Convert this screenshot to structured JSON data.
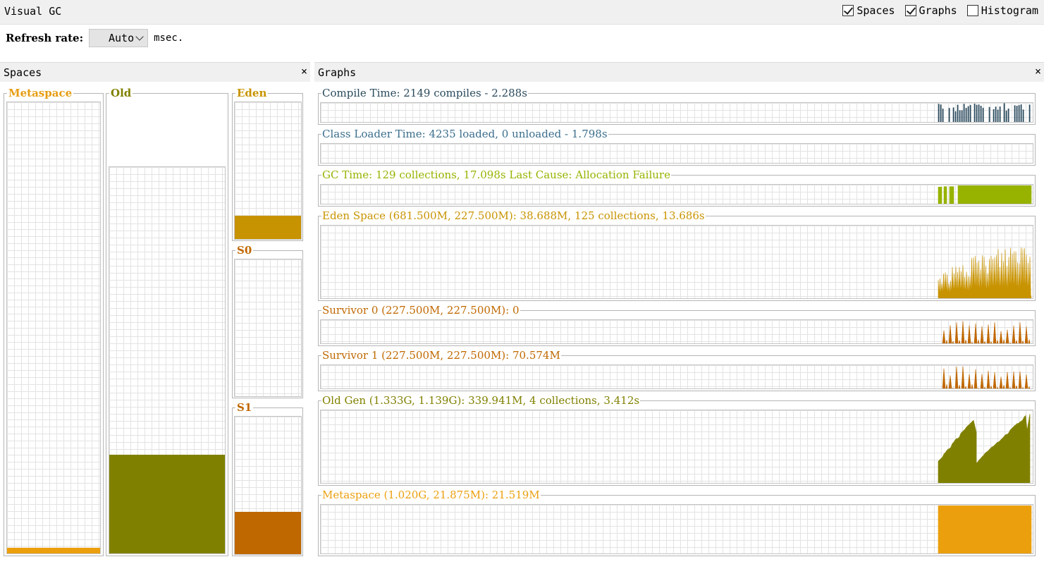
{
  "window": {
    "title": "Visual GC"
  },
  "toggles": [
    {
      "label": "Spaces",
      "checked": true
    },
    {
      "label": "Graphs",
      "checked": true
    },
    {
      "label": "Histogram",
      "checked": false
    }
  ],
  "refresh": {
    "label": "Refresh rate:",
    "value": "Auto",
    "unit": "msec."
  },
  "spaces_panel": {
    "title": "Spaces",
    "close": "×",
    "metaspace": {
      "label": "Metaspace",
      "used_fraction": 0.012,
      "color": "#eb9f0d",
      "label_color": "#e69d12"
    },
    "old": {
      "label": "Old",
      "used_fraction": 0.255,
      "color": "#808000",
      "label_color": "#808000"
    },
    "eden": {
      "label": "Eden",
      "used_fraction": 0.17,
      "color": "#c89300",
      "label_color": "#c89300"
    },
    "s0": {
      "label": "S0",
      "used_fraction": 0.0,
      "color": "#c06800",
      "label_color": "#c06800"
    },
    "s1": {
      "label": "S1",
      "used_fraction": 0.31,
      "color": "#c06800",
      "label_color": "#c06800"
    }
  },
  "graphs_panel": {
    "title": "Graphs",
    "close": "×",
    "graphs": [
      {
        "key": "compile",
        "title": "Compile Time: 2149 compiles - 2.288s",
        "color": "#2a4a5c",
        "kind": "spikes-thin"
      },
      {
        "key": "classloader",
        "title": "Class Loader Time: 4235 loaded, 0 unloaded - 1.798s",
        "color": "#3a6e8c",
        "kind": "none"
      },
      {
        "key": "gc",
        "title": "GC Time: 129 collections, 17.098s  Last Cause: Allocation Failure",
        "color": "#97b300",
        "kind": "block"
      },
      {
        "key": "eden",
        "title": "Eden Space (681.500M, 227.500M): 38.688M, 125 collections, 13.686s",
        "color": "#c89300",
        "kind": "spikes-dense"
      },
      {
        "key": "s0",
        "title": "Survivor 0 (227.500M, 227.500M): 0",
        "color": "#c06800",
        "kind": "spikes-sparse"
      },
      {
        "key": "s1",
        "title": "Survivor 1 (227.500M, 227.500M): 70.574M",
        "color": "#c06800",
        "kind": "spikes-sparse"
      },
      {
        "key": "old",
        "title": "Old Gen (1.333G, 1.139G): 339.941M, 4 collections, 3.412s",
        "color": "#808000",
        "kind": "sawtooth"
      },
      {
        "key": "meta",
        "title": "Metaspace (1.020G, 21.875M): 21.519M",
        "color": "#eb9f0d",
        "kind": "flat"
      }
    ]
  }
}
